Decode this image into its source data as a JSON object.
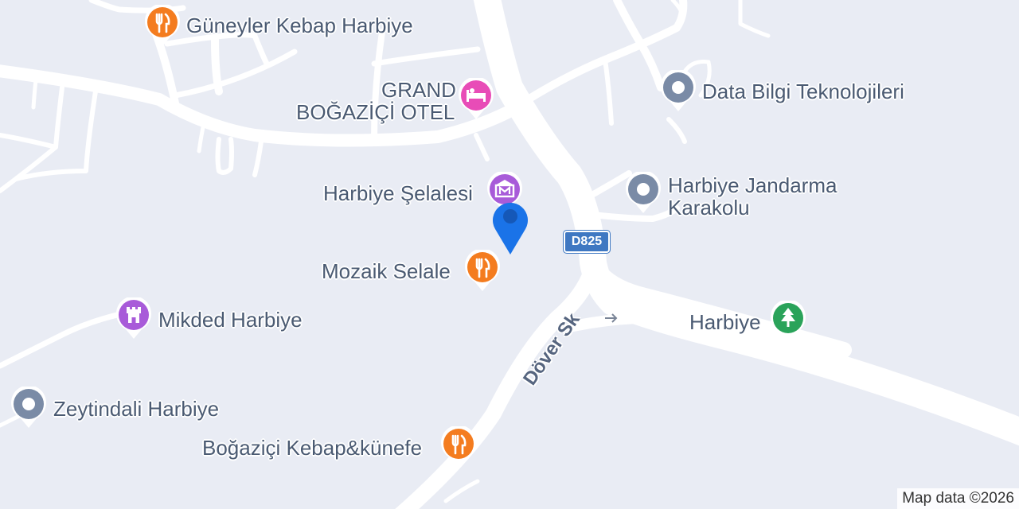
{
  "map": {
    "pois": [
      {
        "label": "Güneyler Kebap Harbiye",
        "category": "restaurant",
        "icon": "fork-knife-icon",
        "color": "#f47c1f"
      },
      {
        "label": "GRAND BOĞAZİÇİ OTEL",
        "label_lines": [
          "GRAND",
          "BOĞAZİÇİ OTEL"
        ],
        "category": "hotel",
        "icon": "bed-icon",
        "color": "#e84cb7"
      },
      {
        "label": "Data Bilgi Teknolojileri",
        "category": "place",
        "icon": "place-icon",
        "color": "#7a8ba6"
      },
      {
        "label": "Harbiye Şelalesi",
        "category": "museum",
        "icon": "museum-icon",
        "color": "#a85bd9"
      },
      {
        "label": "Harbiye Jandarma Karakolu",
        "label_lines": [
          "Harbiye Jandarma",
          "Karakolu"
        ],
        "category": "place",
        "icon": "place-icon",
        "color": "#7a8ba6"
      },
      {
        "label": "Mozaik Selale",
        "category": "restaurant",
        "icon": "fork-knife-icon",
        "color": "#f47c1f"
      },
      {
        "label": "Harbiye",
        "category": "park",
        "icon": "tree-icon",
        "color": "#2aa35a"
      },
      {
        "label": "Mikded Harbiye",
        "category": "historic",
        "icon": "castle-icon",
        "color": "#a85bd9"
      },
      {
        "label": "Zeytindali Harbiye",
        "category": "place",
        "icon": "place-icon",
        "color": "#7a8ba6"
      },
      {
        "label": "Boğaziçi Kebap&künefe",
        "category": "restaurant",
        "icon": "fork-knife-icon",
        "color": "#f47c1f"
      }
    ],
    "road_labels": {
      "street": "Döver Sk",
      "highway_shield": "D825"
    },
    "attribution": "Map data ©2026",
    "colors": {
      "background": "#e9ecf4",
      "road": "#ffffff",
      "user_location": "#1a73e8"
    }
  }
}
